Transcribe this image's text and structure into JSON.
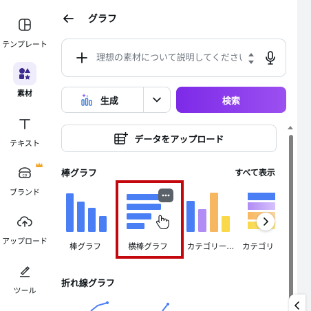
{
  "rail": {
    "items": [
      {
        "label": "テンプレート",
        "icon": "template-icon"
      },
      {
        "label": "素材",
        "icon": "elements-icon",
        "active": true
      },
      {
        "label": "テキスト",
        "icon": "text-icon"
      },
      {
        "label": "ブランド",
        "icon": "brand-icon"
      },
      {
        "label": "アップロード",
        "icon": "upload-icon"
      },
      {
        "label": "ツール",
        "icon": "tools-icon"
      }
    ]
  },
  "header": {
    "title": "グラフ"
  },
  "search": {
    "placeholder": "理想の素材について説明してください"
  },
  "generate": {
    "label": "生成"
  },
  "search_button": {
    "label": "検索"
  },
  "upload_data": {
    "label": "データをアップロード"
  },
  "bar_section": {
    "title": "棒グラフ",
    "see_all": "すべて表示",
    "tiles": [
      {
        "label": "棒グラフ"
      },
      {
        "label": "横棒グラフ"
      },
      {
        "label": "カテゴリー..."
      },
      {
        "label": "カテゴリ"
      }
    ]
  },
  "line_section": {
    "title": "折れ線グラフ"
  },
  "colors": {
    "accent": "#7d2ae8",
    "bar_blue": "#4a7ef5",
    "purple": "#b18cf4",
    "orange": "#f7b760",
    "yellow": "#f9d84a",
    "highlight_red": "#c4060d"
  }
}
